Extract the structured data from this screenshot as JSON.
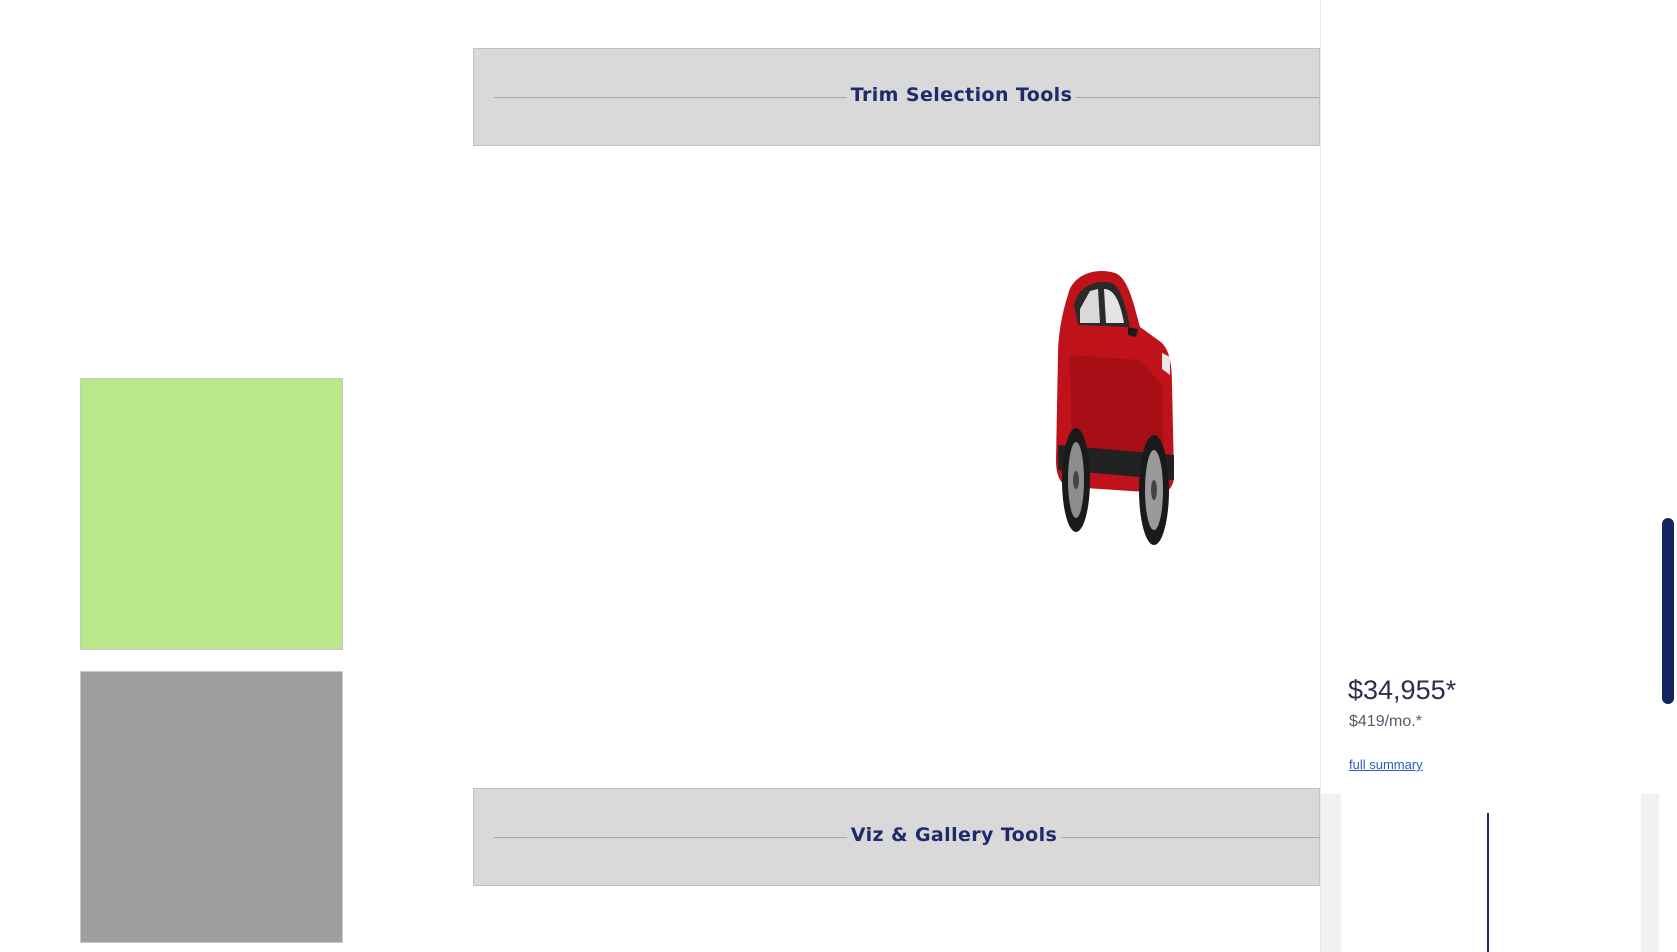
{
  "swatches": {
    "green": "#b8e889",
    "gray": "#9e9e9e"
  },
  "tool_bars": {
    "trim_title": "Trim Selection Tools",
    "viz_title": "Viz & Gallery Tools"
  },
  "vehicle": {
    "body_color": "#c0121a"
  },
  "summary": {
    "price": "$34,955*",
    "monthly": "$419/mo.*",
    "link_label": "full summary"
  },
  "colors": {
    "accent": "#1f2a6b",
    "link": "#2b5bbd",
    "scroll_thumb": "#14245e"
  }
}
